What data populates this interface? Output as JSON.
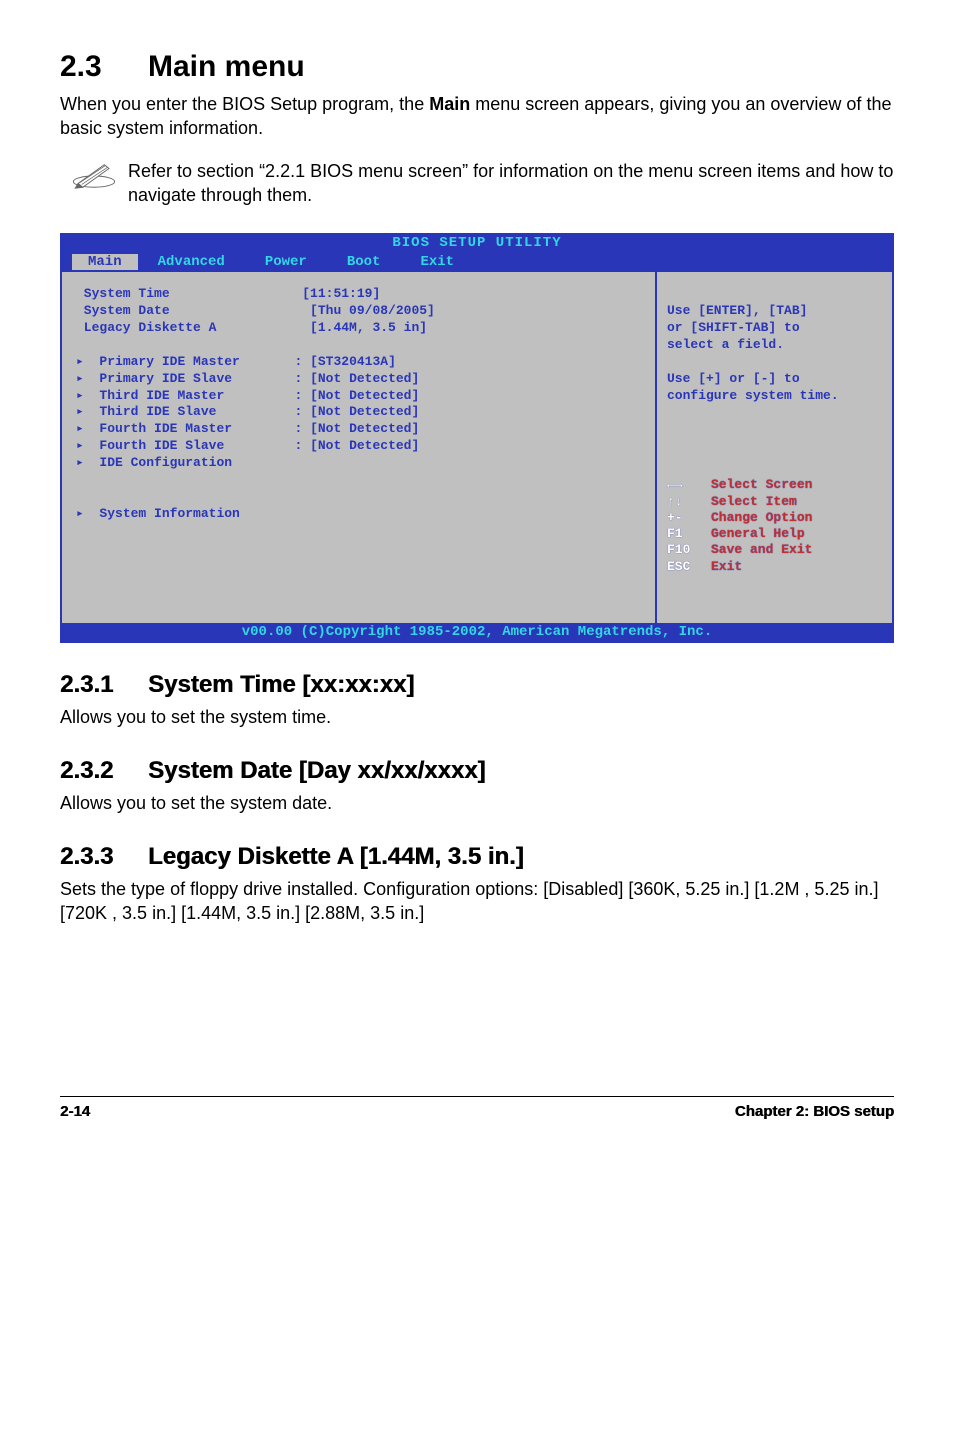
{
  "heading": {
    "num": "2.3",
    "title": "Main menu"
  },
  "intro": {
    "pre": "When you enter the BIOS Setup program, the ",
    "bold": "Main",
    "post": " menu screen appears, giving you an overview of the basic system information."
  },
  "note": "Refer to section “2.2.1  BIOS menu screen” for information on the menu screen items and how to navigate through them.",
  "bios": {
    "title": "BIOS SETUP UTILITY",
    "tabs": [
      "Main",
      "Advanced",
      "Power",
      "Boot",
      "Exit"
    ],
    "active_tab": "Main",
    "rows_top": [
      {
        "label": "System Time",
        "value": "[11:51:19]"
      },
      {
        "label": "System Date",
        "value": " [Thu 09/08/2005]"
      },
      {
        "label": "Legacy Diskette A",
        "value": " [1.44M, 3.5 in]"
      }
    ],
    "rows_mid": [
      {
        "label": "Primary IDE Master",
        "value": ": [ST320413A]"
      },
      {
        "label": "Primary IDE Slave",
        "value": ": [Not Detected]"
      },
      {
        "label": "Third IDE Master",
        "value": ": [Not Detected]"
      },
      {
        "label": "Third IDE Slave",
        "value": ": [Not Detected]"
      },
      {
        "label": "Fourth IDE Master",
        "value": ": [Not Detected]"
      },
      {
        "label": "Fourth IDE Slave",
        "value": ": [Not Detected]"
      },
      {
        "label": "IDE Configuration",
        "value": ""
      }
    ],
    "rows_bot": [
      {
        "label": "System Information",
        "value": ""
      }
    ],
    "help_top": "Use [ENTER], [TAB]\nor [SHIFT-TAB] to\nselect a field.",
    "help_mid": "Use [+] or [-] to\nconfigure system time.",
    "legend": [
      {
        "key": "←→",
        "txt": "Select Screen"
      },
      {
        "key": "↑↓",
        "txt": "Select Item"
      },
      {
        "key": "+-",
        "txt": "Change Option"
      },
      {
        "key": "F1",
        "txt": "General Help"
      },
      {
        "key": "F10",
        "txt": "Save and Exit"
      },
      {
        "key": "ESC",
        "txt": "Exit"
      }
    ],
    "footer": "v00.00 (C)Copyright 1985-2002, American Megatrends, Inc."
  },
  "sections": [
    {
      "num": "2.3.1",
      "title": "System Time [xx:xx:xx]",
      "body": "Allows you to set the system time."
    },
    {
      "num": "2.3.2",
      "title": "System Date [Day xx/xx/xxxx]",
      "body": "Allows you to set the system date."
    },
    {
      "num": "2.3.3",
      "title": "Legacy Diskette A [1.44M, 3.5 in.]",
      "body": "Sets the type of floppy drive installed. Configuration options: [Disabled] [360K, 5.25 in.] [1.2M , 5.25 in.] [720K , 3.5 in.] [1.44M, 3.5 in.] [2.88M, 3.5 in.]"
    }
  ],
  "footer": {
    "left": "2-14",
    "right": "Chapter 2: BIOS setup"
  }
}
